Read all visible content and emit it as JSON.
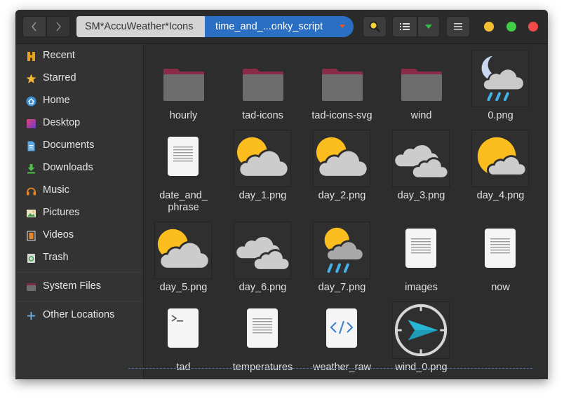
{
  "header": {
    "path_parent": "SM*AccuWeather*Icons",
    "path_current": "time_and_...onky_script"
  },
  "icons": {
    "back": "chevron-left-icon",
    "forward": "chevron-right-icon",
    "search": "search-icon",
    "list_view": "list-view-icon",
    "view_options": "dropdown-arrow-icon",
    "menu": "hamburger-menu-icon"
  },
  "sidebar": {
    "items": [
      {
        "label": "Recent",
        "icon": "recent-icon"
      },
      {
        "label": "Starred",
        "icon": "star-icon"
      },
      {
        "label": "Home",
        "icon": "home-icon"
      },
      {
        "label": "Desktop",
        "icon": "desktop-icon"
      },
      {
        "label": "Documents",
        "icon": "documents-icon"
      },
      {
        "label": "Downloads",
        "icon": "downloads-icon"
      },
      {
        "label": "Music",
        "icon": "music-icon"
      },
      {
        "label": "Pictures",
        "icon": "pictures-icon"
      },
      {
        "label": "Videos",
        "icon": "videos-icon"
      },
      {
        "label": "Trash",
        "icon": "trash-icon"
      },
      {
        "label": "System Files",
        "icon": "system-files-icon"
      },
      {
        "label": "Other Locations",
        "icon": "other-locations-icon"
      }
    ]
  },
  "files": [
    {
      "name": "hourly",
      "kind": "folder"
    },
    {
      "name": "tad-icons",
      "kind": "folder"
    },
    {
      "name": "tad-icons-svg",
      "kind": "folder"
    },
    {
      "name": "wind",
      "kind": "folder"
    },
    {
      "name": "0.png",
      "kind": "night-rain"
    },
    {
      "name": "date_and_\nphrase",
      "kind": "text"
    },
    {
      "name": "day_1.png",
      "kind": "sun-cloud"
    },
    {
      "name": "day_2.png",
      "kind": "sun-cloud"
    },
    {
      "name": "day_3.png",
      "kind": "clouds"
    },
    {
      "name": "day_4.png",
      "kind": "sun-small-cloud"
    },
    {
      "name": "day_5.png",
      "kind": "sun-cloud"
    },
    {
      "name": "day_6.png",
      "kind": "clouds"
    },
    {
      "name": "day_7.png",
      "kind": "sun-rain"
    },
    {
      "name": "images",
      "kind": "text"
    },
    {
      "name": "now",
      "kind": "text"
    },
    {
      "name": "tad",
      "kind": "script"
    },
    {
      "name": "temperatures",
      "kind": "text"
    },
    {
      "name": "weather_raw",
      "kind": "code"
    },
    {
      "name": "wind_0.png",
      "kind": "compass"
    }
  ],
  "colors": {
    "accent": "#2a6fc4",
    "folder": "#8a2c48",
    "sun": "#fbbe1e",
    "cloud": "#cccccc",
    "rain": "#41b3ea",
    "compass_arrow": "#1e9bb6"
  }
}
